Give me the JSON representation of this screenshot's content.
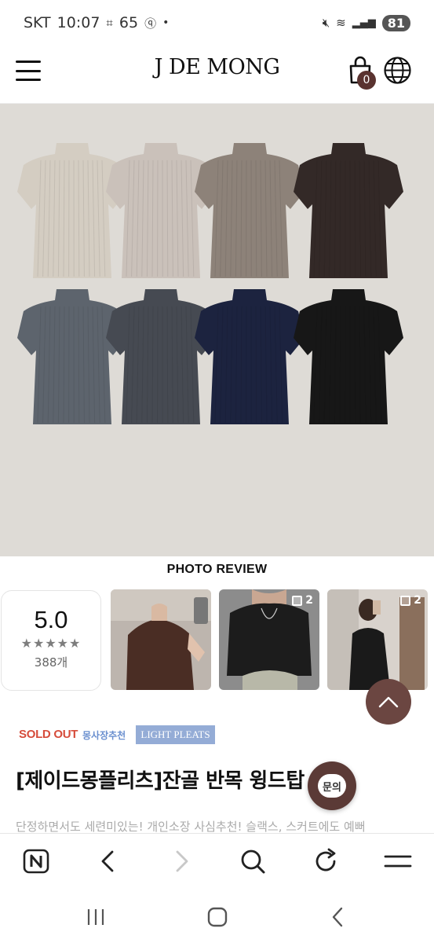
{
  "status_bar": {
    "carrier": "SKT",
    "time": "10:07",
    "data_label": "65",
    "dot": "•",
    "battery": "81"
  },
  "header": {
    "logo": "J DE MONG",
    "cart_count": "0"
  },
  "hero": {
    "shirt_colors_row1": [
      "#d4cdc2",
      "#cac1ba",
      "#8d8279",
      "#332927"
    ],
    "shirt_colors_row2": [
      "#5d646d",
      "#464a52",
      "#1c233f",
      "#171717"
    ]
  },
  "photo_review": {
    "title": "PHOTO REVIEW",
    "score": "5.0",
    "stars": "★★★★★",
    "count": "388개",
    "thumbs": [
      {
        "count": ""
      },
      {
        "count": "2"
      },
      {
        "count": "2"
      }
    ]
  },
  "product": {
    "badge_soldout": "SOLD OUT",
    "badge_recommend": "몽사장추천",
    "badge_light": "LIGHT PLEATS",
    "title": "[제이드몽플리츠]잔골 반목 윙드탑",
    "description": "단정하면서도 세련미있는! 개인소장 사심추천! 슬랙스, 스커트에도 예뻐"
  },
  "floating": {
    "inquiry_label": "문의"
  },
  "icons": {
    "menu": "hamburger-icon",
    "cart": "shopping-bag-icon",
    "globe": "globe-icon",
    "scroll_top": "chevron-up-icon",
    "browser_home": "naver-n-icon",
    "back": "chevron-left-icon",
    "forward": "chevron-right-icon",
    "search": "search-icon",
    "refresh": "refresh-icon",
    "browser_menu": "menu-icon"
  },
  "colors": {
    "accent": "#5b3a36",
    "soldout": "#d64c3b",
    "light_pleats": "#94acd6"
  }
}
